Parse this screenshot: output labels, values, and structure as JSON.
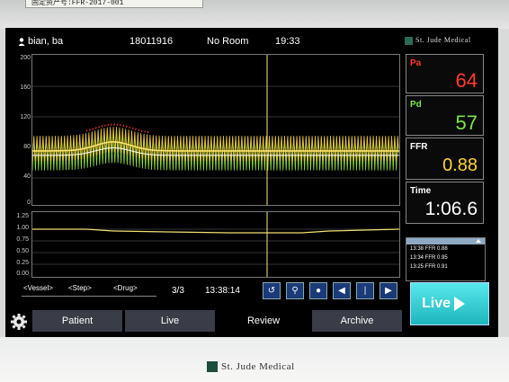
{
  "asset_label": "固定资产号:FFR-2017-001",
  "header": {
    "patient_name": "bian, ba",
    "patient_id": "18011916",
    "room": "No Room",
    "time": "19:33",
    "brand": "St. Jude Medical"
  },
  "pressure_axis": {
    "ticks": [
      "200",
      "160",
      "120",
      "80",
      "40",
      "0"
    ]
  },
  "ratio_axis": {
    "ticks": [
      "1.25",
      "1.00",
      "0.75",
      "0.50",
      "0.25",
      "0.00"
    ]
  },
  "readouts": {
    "pa": {
      "label": "Pa",
      "value": "64",
      "color": "#ff3b2f"
    },
    "pd": {
      "label": "Pd",
      "value": "57",
      "color": "#7be34a"
    },
    "ffr": {
      "label": "FFR",
      "value": "0.88",
      "color": "#ffd23a"
    },
    "time": {
      "label": "Time",
      "value": "1:06.6",
      "color": "#ffffff"
    }
  },
  "history": [
    "13:38 FFR 0.88",
    "13:34 FFR 0.95",
    "13:25 FFR 0.91"
  ],
  "nav": {
    "vessel": "<Vessel>",
    "step": "<Step>",
    "drug": "<Drug>",
    "page": "3/3",
    "cursor_time": "13:38:14"
  },
  "controls": [
    "undo-icon",
    "zoom-in-icon",
    "marker-icon",
    "prev-icon",
    "cursor-icon",
    "next-icon"
  ],
  "tabs": {
    "patient": "Patient",
    "live": "Live",
    "review": "Review",
    "archive": "Archive"
  },
  "live_button": "Live",
  "colors": {
    "accent": "#1cb6bd",
    "tab_active": "#000000",
    "tab": "#3a3d47"
  }
}
